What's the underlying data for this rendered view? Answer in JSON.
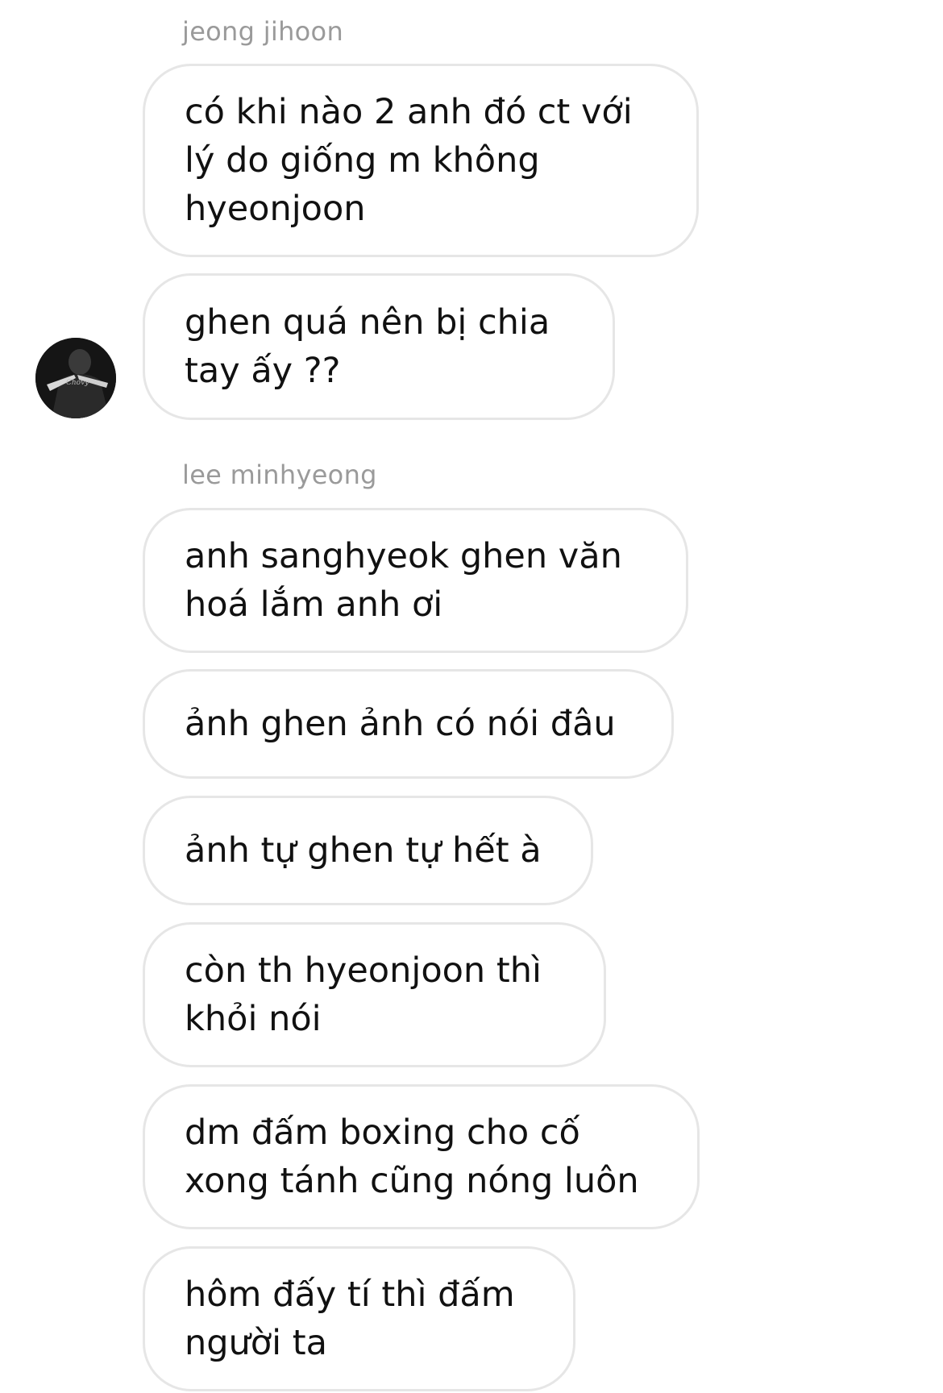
{
  "thread": {
    "groups": [
      {
        "sender": "jeong jihoon",
        "messages": [
          "có khi nào 2 anh đó ct với\nlý do giống m không\nhyeonjoon",
          "ghen quá nên bị chia\ntay ấy ??"
        ]
      },
      {
        "sender": "lee minhyeong",
        "messages": [
          "anh sanghyeok ghen văn\nhoá lắm anh ơi",
          "ảnh ghen ảnh có nói đâu",
          "ảnh tự ghen tự hết à",
          "còn th hyeonjoon thì\nkhỏi nói",
          "dm đấm boxing cho cố\nxong tánh cũng nóng luôn",
          "hôm đấy tí thì đấm\nngười ta"
        ]
      }
    ]
  },
  "colors": {
    "bubble_border": "#e6e6e6",
    "sender_name": "#9a9a9a",
    "text": "#111111",
    "background": "#ffffff"
  }
}
